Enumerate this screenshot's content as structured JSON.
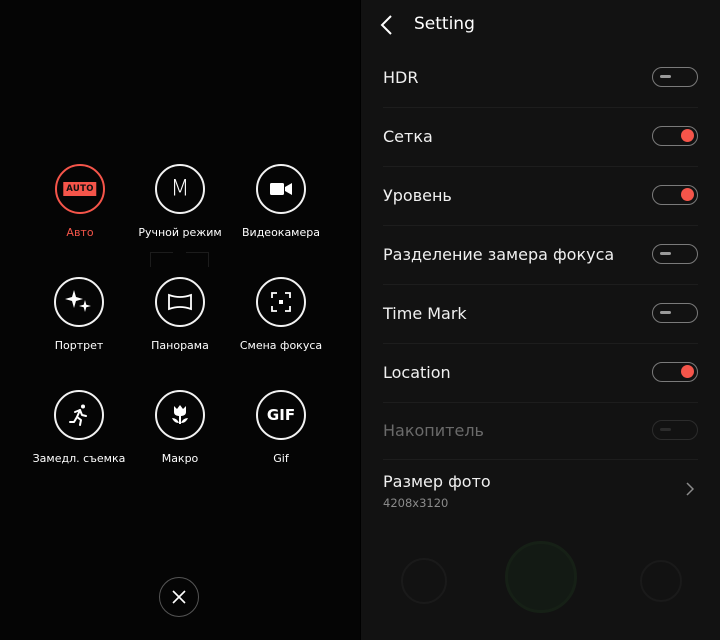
{
  "modes": [
    {
      "label": "Авто",
      "icon": "auto-icon",
      "badge": "AUTO",
      "active": true
    },
    {
      "label": "Ручной режим",
      "icon": "manual-m-icon",
      "glyph": "M"
    },
    {
      "label": "Видеокамера",
      "icon": "video-camera-icon"
    },
    {
      "label": "Портрет",
      "icon": "sparkle-icon"
    },
    {
      "label": "Панорама",
      "icon": "panorama-icon"
    },
    {
      "label": "Смена фокуса",
      "icon": "focus-frame-icon"
    },
    {
      "label": "Замедл. съемка",
      "icon": "running-person-icon"
    },
    {
      "label": "Макро",
      "icon": "flower-icon"
    },
    {
      "label": "Gif",
      "icon": "gif-icon",
      "glyph": "GIF"
    }
  ],
  "settings": {
    "title": "Setting",
    "rows": [
      {
        "label": "HDR",
        "on": false,
        "enabled": true
      },
      {
        "label": "Сетка",
        "on": true,
        "enabled": true
      },
      {
        "label": "Уровень",
        "on": true,
        "enabled": true
      },
      {
        "label": "Разделение замера фокуса",
        "on": false,
        "enabled": true
      },
      {
        "label": "Time Mark",
        "on": false,
        "enabled": true
      },
      {
        "label": "Location",
        "on": true,
        "enabled": true
      },
      {
        "label": "Накопитель",
        "on": false,
        "enabled": false
      }
    ],
    "photo_size": {
      "label": "Размер фото",
      "value": "4208x3120"
    }
  },
  "colors": {
    "accent": "#f5554a",
    "panel": "#121212",
    "background": "#000000"
  }
}
